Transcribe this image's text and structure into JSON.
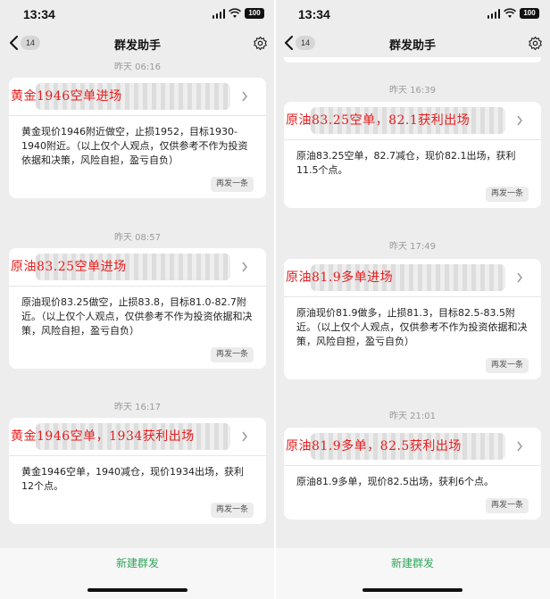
{
  "status": {
    "time": "13:34",
    "battery": "100"
  },
  "nav": {
    "badge": "14",
    "title": "群发助手"
  },
  "left": {
    "top_timestamp": "昨天 06:16",
    "messages": [
      {
        "timestamp": "",
        "overlay": "黄金1946空单进场",
        "body": "黄金现价1946附近做空，止损1952，目标1930-1940附近。（以上仅个人观点，仅供参考不作为投资依据和决策，风险自担，盈亏自负）",
        "resend": "再发一条"
      },
      {
        "timestamp": "昨天 08:57",
        "overlay": "原油83.25空单进场",
        "body": "原油现价83.25做空，止损83.8，目标81.0-82.7附近。（以上仅个人观点，仅供参考不作为投资依据和决策，风险自担，盈亏自负）",
        "resend": "再发一条"
      },
      {
        "timestamp": "昨天 16:17",
        "overlay": "黄金1946空单，1934获利出场",
        "body": "黄金1946空单，1940减仓，现价1934出场，获利12个点。",
        "resend": "再发一条"
      }
    ]
  },
  "right": {
    "messages": [
      {
        "timestamp": "昨天 16:39",
        "overlay": "原油83.25空单，82.1获利出场",
        "body": "原油83.25空单，82.7减仓，现价82.1出场，获利11.5个点。",
        "resend": "再发一条"
      },
      {
        "timestamp": "昨天 17:49",
        "overlay": "原油81.9多单进场",
        "body": "原油现价81.9做多，止损81.3，目标82.5-83.5附近。（以上仅个人观点，仅供参考不作为投资依据和决策，风险自担，盈亏自负）",
        "resend": "再发一条"
      },
      {
        "timestamp": "昨天 21:01",
        "overlay": "原油81.9多单，82.5获利出场",
        "body": "原油81.9多单，现价82.5出场，获利6个点。",
        "resend": "再发一条"
      }
    ]
  },
  "bottom": {
    "new_group": "新建群发"
  },
  "colors": {
    "overlay_red": "#e81c1c",
    "accent_green": "#2fa65a",
    "background": "#ededed"
  }
}
